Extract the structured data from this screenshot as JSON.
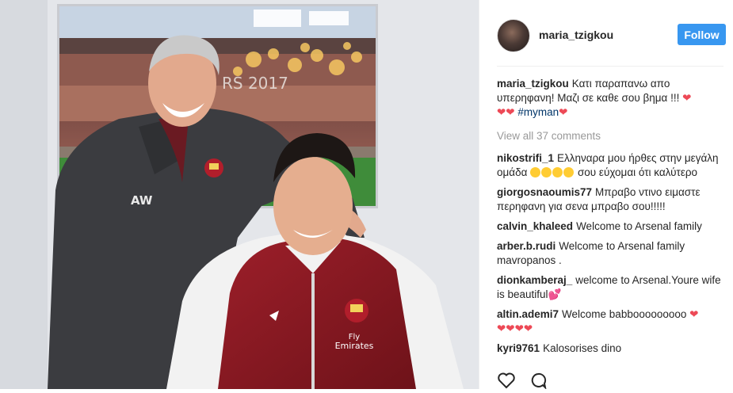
{
  "post": {
    "username": "maria_tzigkou",
    "follow_label": "Follow",
    "icons": {
      "avatar": "profile-photo",
      "like": "heart-outline-icon",
      "comment": "comment-bubble-icon"
    },
    "colors": {
      "follow_bg": "#3897f0",
      "heart": "#ed4956",
      "link": "#003569",
      "muted": "#999999"
    }
  },
  "caption": {
    "user": "maria_tzigkou",
    "text": "Κατι παραπανω απο υπερηφανη! Μαζι σε καθε σου βημα !!!",
    "hashtag": "#myman"
  },
  "view_all": "View all 37 comments",
  "comments": [
    {
      "user": "nikostrifi_1",
      "text_before": "Ελληναρα μου ήρθες στην μεγάλη ομάδα",
      "text_after": "σου εύχομαι ότι καλύτερο"
    },
    {
      "user": "giorgosnaoumis77",
      "text": "Μπραβο ντινο ειμαστε περηφανη για σενα μπραβο σου!!!!!"
    },
    {
      "user": "calvin_khaleed",
      "text": "Welcome to Arsenal family"
    },
    {
      "user": "arber.b.rudi",
      "text": "Welcome to Arsenal family mavropanos ."
    },
    {
      "user": "dionkamberaj_",
      "text": "welcome to Arsenal.Youre wife is beautiful"
    },
    {
      "user": "altin.ademi7",
      "text": "Welcome babbooooooooo"
    },
    {
      "user": "kyri9761",
      "text": "Kalosorises dino"
    }
  ],
  "photo": {
    "banner_text": "RS 2017",
    "jacket_initials": "AW",
    "sponsor_line1": "Fly",
    "sponsor_line2": "Emirates"
  }
}
